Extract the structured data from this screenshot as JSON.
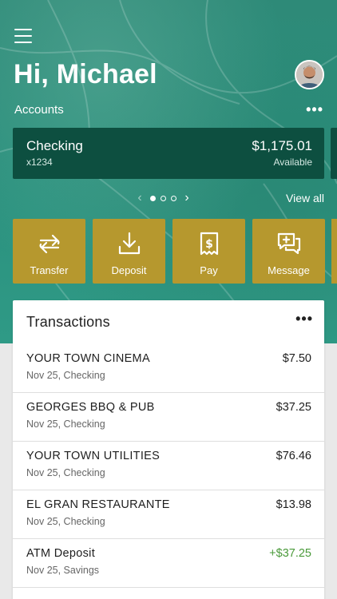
{
  "header": {
    "greeting": "Hi, Michael",
    "accounts_label": "Accounts",
    "more_label": "•••"
  },
  "account_card": {
    "name": "Checking",
    "number": "x1234",
    "balance": "$1,175.01",
    "balance_label": "Available"
  },
  "carousel": {
    "prev_label": "‹",
    "next_label": "›",
    "view_all": "View all"
  },
  "actions": [
    {
      "label": "Transfer",
      "icon": "transfer-icon"
    },
    {
      "label": "Deposit",
      "icon": "deposit-icon"
    },
    {
      "label": "Pay",
      "icon": "pay-icon"
    },
    {
      "label": "Message",
      "icon": "message-icon"
    }
  ],
  "transactions": {
    "title": "Transactions",
    "more_label": "•••",
    "items": [
      {
        "merchant": "YOUR TOWN CINEMA",
        "detail": "Nov 25, Checking",
        "amount": "$7.50"
      },
      {
        "merchant": "GEORGES BBQ & PUB",
        "detail": "Nov 25, Checking",
        "amount": "$37.25"
      },
      {
        "merchant": "YOUR TOWN UTILITIES",
        "detail": "Nov 25, Checking",
        "amount": "$76.46"
      },
      {
        "merchant": "EL GRAN RESTAURANTE",
        "detail": "Nov 25, Checking",
        "amount": "$13.98"
      },
      {
        "merchant": "ATM Deposit",
        "detail": "Nov 25, Savings",
        "amount": "+$37.25"
      }
    ]
  },
  "colors": {
    "hero": "#2a8f7c",
    "card": "#0d4f40",
    "action": "#b6982e",
    "credit": "#4a9a3a"
  }
}
